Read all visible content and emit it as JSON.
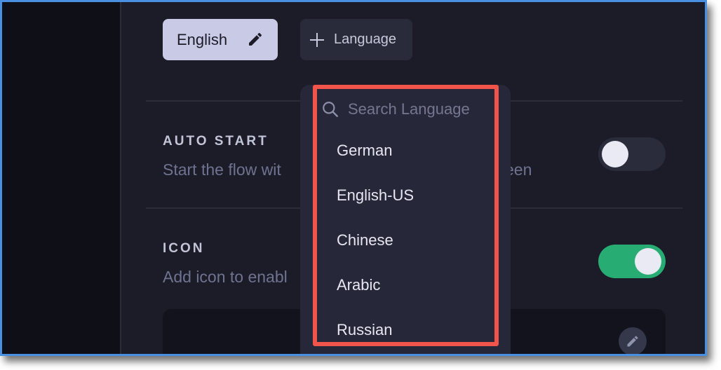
{
  "language_chips": {
    "current": "English",
    "add_label": "Language"
  },
  "auto_start": {
    "title": "AUTO START",
    "description_left": "Start the flow wit",
    "description_right": "een",
    "enabled": false
  },
  "icon_section": {
    "title": "ICON",
    "description": "Add icon to enabl",
    "enabled": true
  },
  "language_dropdown": {
    "search_placeholder": "Search Language",
    "options": [
      "German",
      "English-US",
      "Chinese",
      "Arabic",
      "Russian"
    ]
  },
  "colors": {
    "toggle_on": "#27ad73",
    "highlight": "#f0544a",
    "frame_border": "#4a90e2"
  },
  "icons": {
    "edit": "pencil-icon",
    "add": "plus-icon",
    "search": "search-icon"
  }
}
